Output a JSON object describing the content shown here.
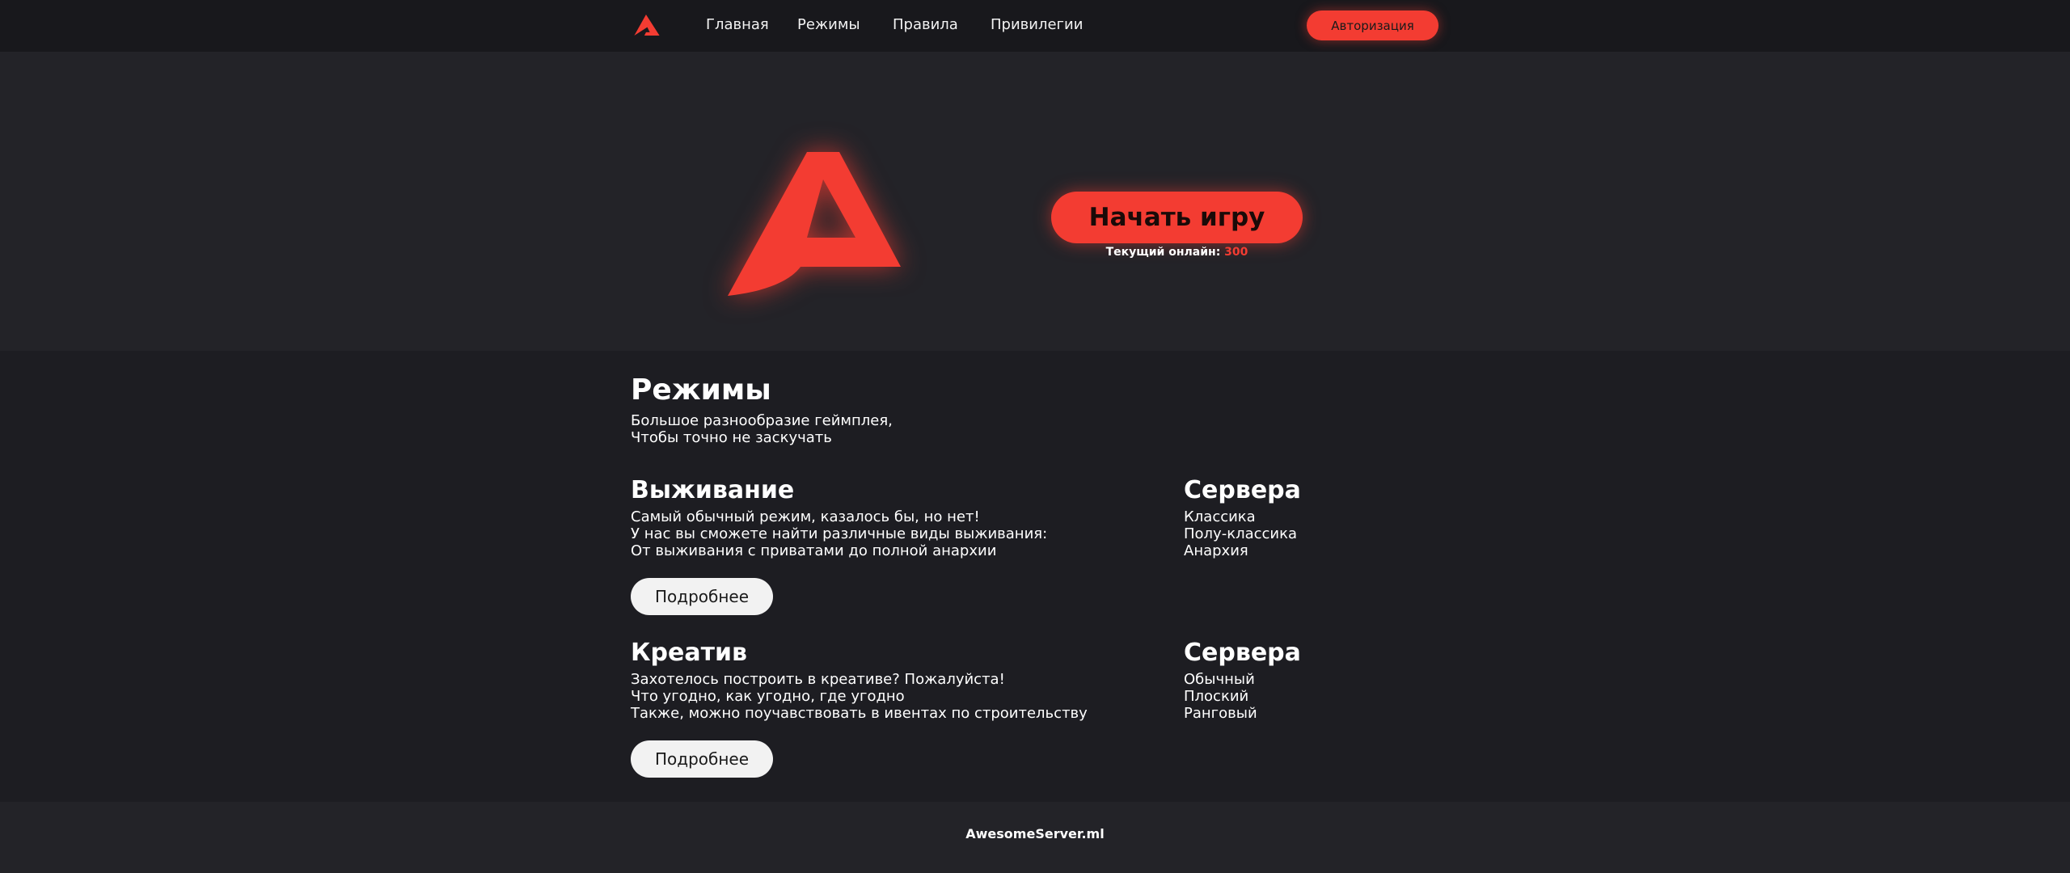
{
  "nav": {
    "logo_icon": "a-logo-icon",
    "links": [
      "Главная",
      "Режимы",
      "Правила",
      "Привилегии"
    ],
    "auth_label": "Авторизация"
  },
  "hero": {
    "logo_icon": "a-logo-icon",
    "play_label": "Начать игру",
    "online_label": "Текущий онлайн:",
    "online_count": "300"
  },
  "modes": {
    "title": "Режимы",
    "subtitle": [
      "Большое разнообразие геймплея,",
      "Чтобы точно не заскучать"
    ],
    "items": [
      {
        "title": "Выживание",
        "description": [
          "Самый обычный режим, казалось бы, но нет!",
          "У нас вы сможете найти различные виды выживания:",
          "От выживания с приватами до полной анархии"
        ],
        "button_label": "Подробнее",
        "servers_title": "Сервера",
        "servers": [
          "Классика",
          "Полу-классика",
          "Анархия"
        ]
      },
      {
        "title": "Креатив",
        "description": [
          "Захотелось построить в креативе? Пожалуйста!",
          "Что угодно, как угодно, где угодно",
          "Также, можно поучавствовать в ивентах по строительству"
        ],
        "button_label": "Подробнее",
        "servers_title": "Сервера",
        "servers": [
          "Обычный",
          "Плоский",
          "Ранговый"
        ]
      }
    ]
  },
  "footer": {
    "text": "AwesomeServer.ml"
  },
  "colors": {
    "accent": "#f33c32",
    "background": "#1d1d22",
    "hero_background": "#232328",
    "navbar": "#18181c"
  }
}
